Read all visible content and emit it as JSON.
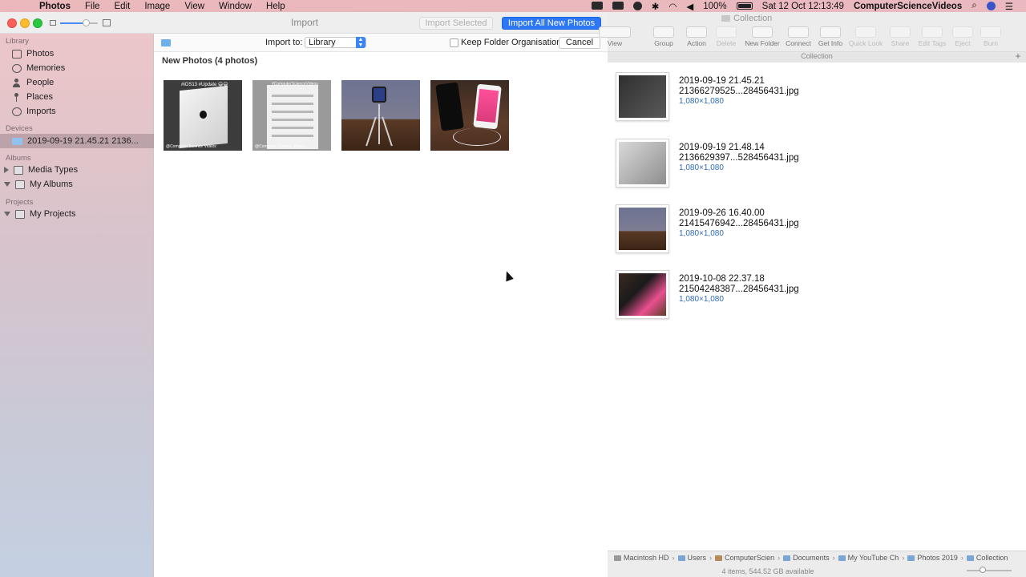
{
  "menubar": {
    "app_name": "Photos",
    "items": [
      "File",
      "Edit",
      "Image",
      "View",
      "Window",
      "Help"
    ],
    "battery": "100%",
    "datetime": "Sat 12 Oct  12:13:49",
    "username": "ComputerScienceVideos"
  },
  "photos_window": {
    "title": "Import",
    "import_selected_label": "Import Selected",
    "import_all_label": "Import All New Photos",
    "sidebar": {
      "library_header": "Library",
      "library_items": [
        "Photos",
        "Memories",
        "People",
        "Places",
        "Imports"
      ],
      "devices_header": "Devices",
      "device_item": "2019-09-19 21.45.21 2136...",
      "albums_header": "Albums",
      "album_items": [
        "Media Types",
        "My Albums"
      ],
      "projects_header": "Projects",
      "project_items": [
        "My Projects"
      ]
    },
    "import_bar": {
      "import_to_label": "Import to:",
      "destination": "Library",
      "keep_folder_label": "Keep Folder Organisation",
      "cancel_label": "Cancel"
    },
    "new_photos_title": "New Photos (4 photos)",
    "thumbnails": [
      {
        "caption": "#iOS13 #Update 😄😄",
        "watermark": "@Computer Science Videos"
      },
      {
        "caption": "#ComputerScienceVideos",
        "watermark": "@Computer Science Videos"
      },
      {
        "caption": "",
        "watermark": ""
      },
      {
        "caption": "",
        "watermark": ""
      }
    ]
  },
  "finder": {
    "title": "Collection",
    "toolbar": {
      "view": "View",
      "group": "Group",
      "action": "Action",
      "delete": "Delete",
      "new_folder": "New Folder",
      "connect": "Connect",
      "get_info": "Get Info",
      "quick_look": "Quick Look",
      "share": "Share",
      "edit_tags": "Edit Tags",
      "eject": "Eject",
      "burn": "Burn"
    },
    "path_title": "Collection",
    "files": [
      {
        "line1": "2019-09-19 21.45.21",
        "line2": "21366279525...28456431.jpg",
        "dims": "1,080×1,080"
      },
      {
        "line1": "2019-09-19 21.48.14",
        "line2": "2136629397...528456431.jpg",
        "dims": "1,080×1,080"
      },
      {
        "line1": "2019-09-26 16.40.00",
        "line2": "21415476942...28456431.jpg",
        "dims": "1,080×1,080"
      },
      {
        "line1": "2019-10-08 22.37.18",
        "line2": "21504248387...28456431.jpg",
        "dims": "1,080×1,080"
      }
    ],
    "breadcrumb": [
      "Macintosh HD",
      "Users",
      "ComputerScien",
      "Documents",
      "My YouTube Ch",
      "Photos 2019",
      "Collection"
    ],
    "status": "4 items, 544.52 GB available"
  },
  "colors": {
    "accent": "#2d77f5",
    "dims_text": "#2e6bb3",
    "sidebar_selection": "#8f7c86"
  },
  "icons": {
    "apple_logo": "apple-icon",
    "folder": "folder-icon",
    "wifi": "wifi-icon",
    "search": "search-icon"
  }
}
